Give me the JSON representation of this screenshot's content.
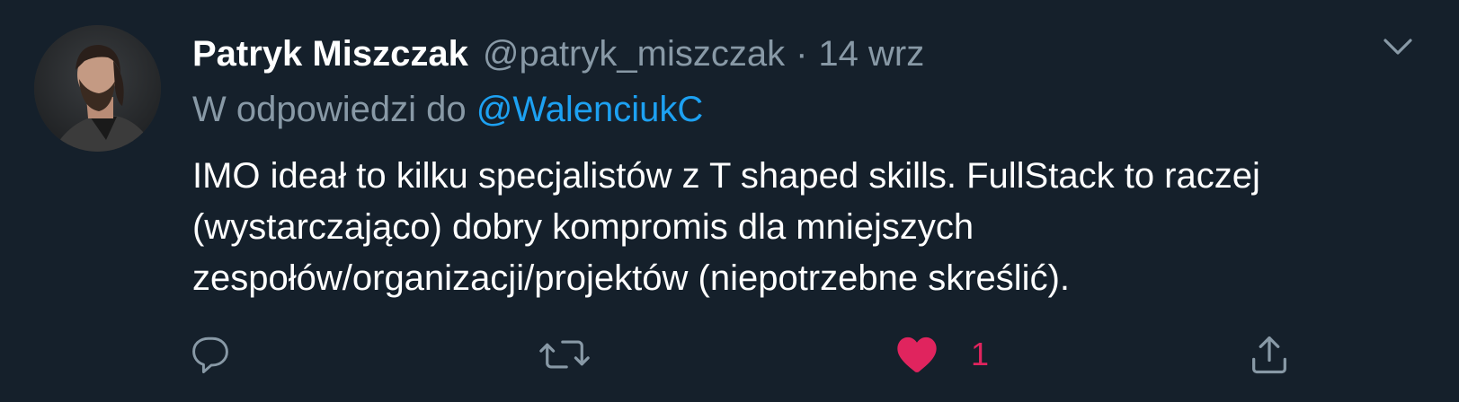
{
  "tweet": {
    "author_name": "Patryk Miszczak",
    "author_handle": "@patryk_miszczak",
    "separator": "·",
    "date": "14 wrz",
    "reply_prefix": "W odpowiedzi do ",
    "reply_to": "@WalenciukC",
    "text_lines": [
      "IMO ideał to kilku specjalistów z T shaped skills. FullStack to raczej",
      "(wystarczająco) dobry kompromis dla mniejszych",
      "zespołów/organizacji/projektów (niepotrzebne skreślić)."
    ],
    "like_count": "1",
    "liked": true
  },
  "icons": {
    "avatar": "avatar",
    "menu": "chevron-down-icon",
    "reply": "reply-icon",
    "retweet": "retweet-icon",
    "like": "heart-icon",
    "share": "share-icon"
  },
  "colors": {
    "background": "#15202b",
    "secondary_text": "#8899a6",
    "link": "#1da1f2",
    "like": "#e0245e"
  }
}
